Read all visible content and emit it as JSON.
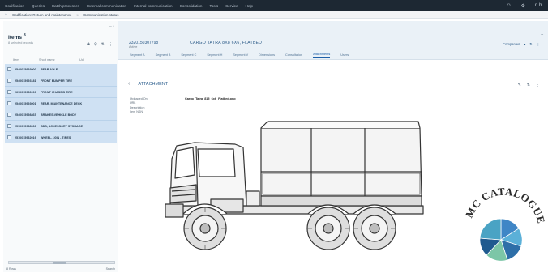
{
  "topbar": {
    "menu": [
      "Codification",
      "Queries",
      "Batch processes",
      "External communication",
      "Internal communication",
      "Consolidation",
      "Tools",
      "Service",
      "Help"
    ],
    "right_icons": [
      "user-icon",
      "settings-icon"
    ],
    "user_initials": "n.h."
  },
  "breadcrumb": {
    "items": [
      "Codification: Return and maintenance",
      "Communication status"
    ]
  },
  "items_pane": {
    "title": "Items",
    "title_badge": "8",
    "subtitle": "8 selected records",
    "columns": [
      "Item",
      "Short name",
      "UoI"
    ],
    "rows": [
      {
        "code": "2540015993000",
        "desc": "REAR AXLE"
      },
      {
        "code": "2540015993181",
        "desc": "FRONT BUMPER TIRE"
      },
      {
        "code": "2610015980096",
        "desc": "FRONT CHASSIS TIRE"
      },
      {
        "code": "2540015993001",
        "desc": "REAR, MAINTENANCE DECK"
      },
      {
        "code": "2540015998465",
        "desc": "BRAKES VEHICLE BODY"
      },
      {
        "code": "2510015938966",
        "desc": "BDS, ACCESSORY STORAGE"
      },
      {
        "code": "2510015932016",
        "desc": "WHEEL, 20IN - TIRES"
      }
    ],
    "footer_left": "8 Rows",
    "footer_right": "Search"
  },
  "detail": {
    "object_code": "2320150307798",
    "status": "Active",
    "object_title": "CARGO TATRA 8X8 6X6, FLATBED",
    "actions_label": "Companies",
    "tabs": [
      "Segment A",
      "Segment B",
      "Segment C",
      "Segment H",
      "Segment V",
      "Dimensions",
      "Consultation",
      "Attachments",
      "Users"
    ],
    "active_tab": "Attachments",
    "section_title": "ATTACHMENT",
    "info_labels": [
      "Uploaded On",
      "URL",
      "Description",
      "Item NSN"
    ],
    "file_name": "Cargo_Tatra_815_6x6_Flatbed.png",
    "logo_text": "MC CATALOGUE"
  },
  "colors": {
    "topbar": "#1d2833",
    "row_selected": "#cfe1f3",
    "accent": "#1d5fa8",
    "header_bg": "#eaf1f7"
  }
}
